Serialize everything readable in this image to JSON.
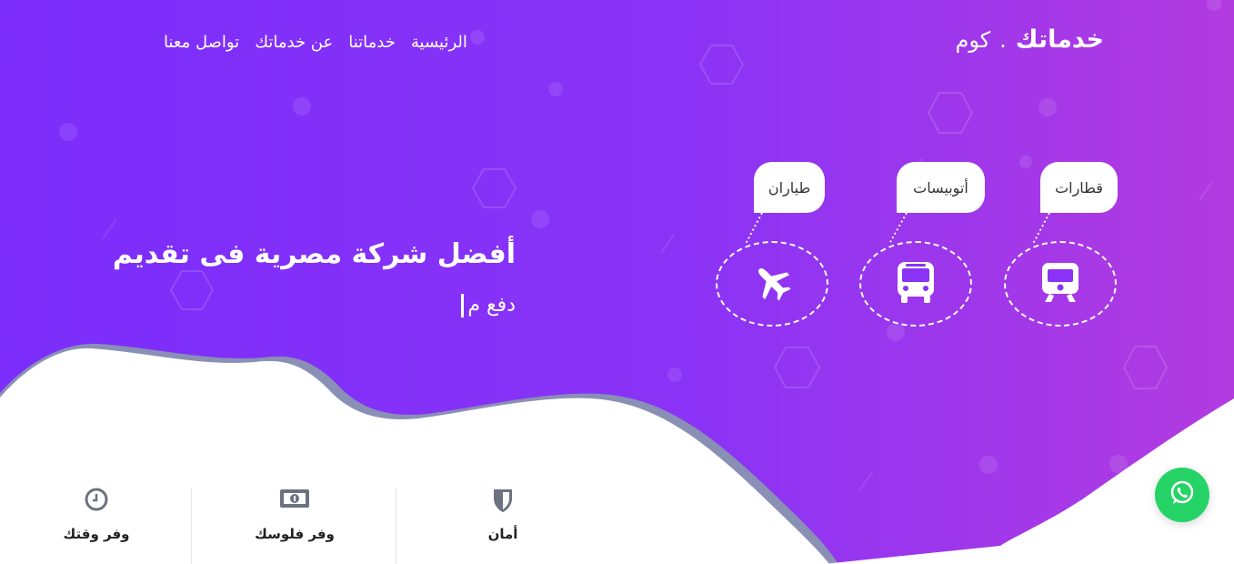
{
  "brand": {
    "name": "خدماتك",
    "separator": ".",
    "suffix": "كوم"
  },
  "nav": {
    "items": [
      {
        "label": "الرئيسية"
      },
      {
        "label": "خدماتنا"
      },
      {
        "label": "عن خدماتك"
      },
      {
        "label": "تواصل معنا"
      }
    ]
  },
  "hero": {
    "headline": "أفضل شركة مصرية فى تقديم",
    "typed_text": "دفع م"
  },
  "services": [
    {
      "label": "قطارات",
      "icon": "train-icon"
    },
    {
      "label": "أتوبيسات",
      "icon": "bus-icon"
    },
    {
      "label": "طياران",
      "icon": "airplane-icon"
    }
  ],
  "features": [
    {
      "label": "أمان",
      "icon": "shield-icon"
    },
    {
      "label": "وفر فلوسك",
      "icon": "money-icon"
    },
    {
      "label": "وفر وقتك",
      "icon": "clock-icon"
    }
  ],
  "whatsapp": {
    "icon": "whatsapp-icon"
  },
  "colors": {
    "gradient_start": "#7b2dfb",
    "gradient_end": "#b23be0",
    "whatsapp": "#25d366",
    "icon_gray": "#6b7280"
  }
}
